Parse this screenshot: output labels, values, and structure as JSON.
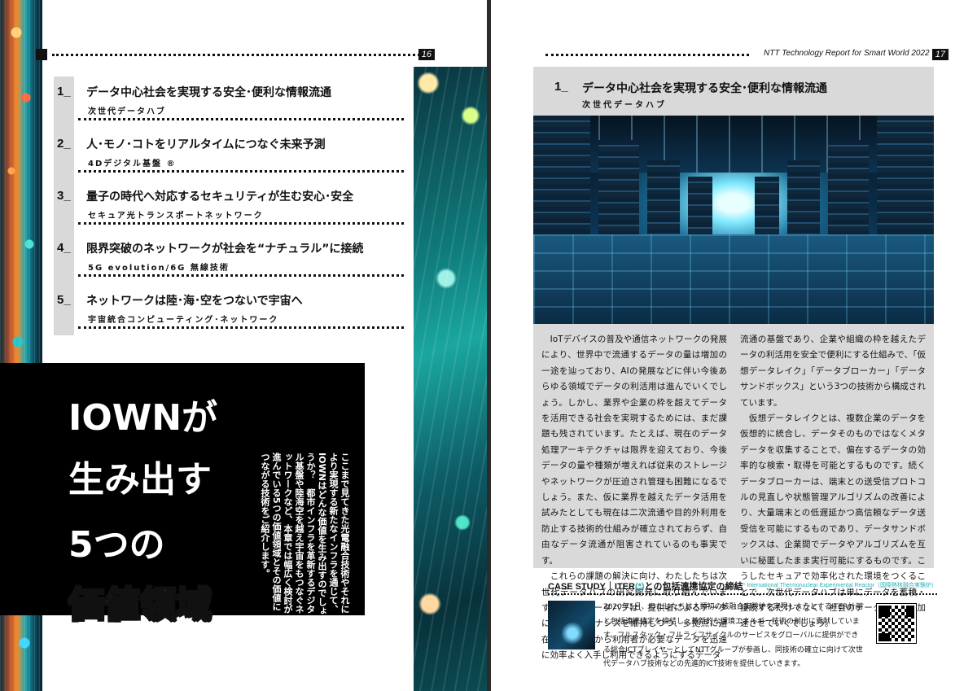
{
  "left_page": {
    "page_number": "16",
    "toc": [
      {
        "number": "1_",
        "title": "データ中心社会を実現する安全･便利な情報流通",
        "subtitle": "次世代データハブ"
      },
      {
        "number": "2_",
        "title": "人･モノ･コトをリアルタイムにつなぐ未来予測",
        "subtitle": "4Dデジタル基盤 ®"
      },
      {
        "number": "3_",
        "title": "量子の時代へ対応するセキュリティが生む安心･安全",
        "subtitle": "セキュア光トランスポートネットワーク"
      },
      {
        "number": "4_",
        "title": "限界突破のネットワークが社会を“ナチュラル”に接続",
        "subtitle": "5G evolution/6G 無線技術"
      },
      {
        "number": "5_",
        "title": "ネットワークは陸･海･空をつないで宇宙へ",
        "subtitle": "宇宙統合コンピューティング･ネットワーク"
      }
    ],
    "headline": [
      "IOWNが",
      "生み出す",
      "5つの",
      "価値領域"
    ],
    "intro": "ここまで見てきた光電融合技術やそれにより実現する新たなインフラを通じて、IOWNはどんな価値を生み出すのでしょうか？　都市インフラを革新するデジタル基盤や陸海空を越え宇宙をもつなぐネットワークなど、本章では幅広く検討が進んでいる5つの価値領域とその価値につながる技術をご紹介します。"
  },
  "right_page": {
    "running_title": "NTT Technology Report for Smart World 2022",
    "page_number": "17",
    "article": {
      "number": "1_",
      "title": "データ中心社会を実現する安全･便利な情報流通",
      "subtitle": "次世代データハブ",
      "image_icon": "data-center-photo",
      "col1": "　IoTデバイスの普及や通信ネットワークの発展により、世界中で流通するデータの量は増加の一途を辿っており、AIの発展などに伴い今後あらゆる領域でデータの利活用は進んでいくでしょう。しかし、業界や企業の枠を超えてデータを活用できる社会を実現するためには、まだ課題も残されています。たとえば、現在のデータ処理アーキテクチャは限界を迎えており、今後データの量や種類が増えれば従来のストレージやネットワークが圧迫され管理も困難になるでしょう。また、仮に業界を越えたデータ活用を試みたとしても現在は二次流通や目的外利用を防止する技術的仕組みが確立されておらず、自由なデータ流通が阻害されているのも事実です。\n　これらの課題の解決に向け、わたしたちは次世代データハブの研究開発に取り組んでいます。次世代データハブは、提供者によるデータに対するガバナンスを維持しつつ、多拠点に遍在するデータから利用者が必要なデータを迅速に効率よく入手し利用できるようにするデータ",
      "col2": "流通の基盤であり、企業や組織の枠を越えたデータの利活用を安全で便利にする仕組みで、「仮想データレイク」「データブローカー」「データサンドボックス」という3つの技術から構成されています。\n　仮想データレイクとは、複数企業のデータを仮想的に統合し、データそのものではなくメタデータを収集することで、偏在するデータの効率的な検索・取得を可能とするものです。続くデータブローカーは、端末との送受信プロトコルの見直しや状態管理アルゴリズムの改善により、大量端末との低遅延かつ高信頼なデータ送受信を可能にするものであり、データサンドボックスは、企業間でデータやアルゴリズムを互いに秘匿したまま実行可能にするものです。こうしたセキュアで効率化された環境をつくることで、次世代データハブは単にデータを蓄積・接続するだけでなく、社会のデータ利活用を加速させていくでしょう。"
    },
    "case_study": {
      "label": "CASE STUDY｜ITER",
      "asterisk": "(*)",
      "label_rest": "との包括連携協定の締結",
      "note": "* International Thermonuclear Experimental Reactor（国際熱核融合実験炉）",
      "text": "2020年5月、わたしたちは人類初の核融合実験炉を実現しようとするITER計画と包括連携協定を締結し、革新的な環境エネルギー技術の創出に貢献しています。フルスタック・フルライフサイクルのサービスをグローバルに提供ができる総合ICTプレイヤーとしてNTTグループが参画し、同技術の確立に向けて次世代データハブ技術などの先進的ICT技術を提供していきます。",
      "image_icon": "hands-laptop-photo",
      "qr_icon": "qr-code"
    }
  }
}
